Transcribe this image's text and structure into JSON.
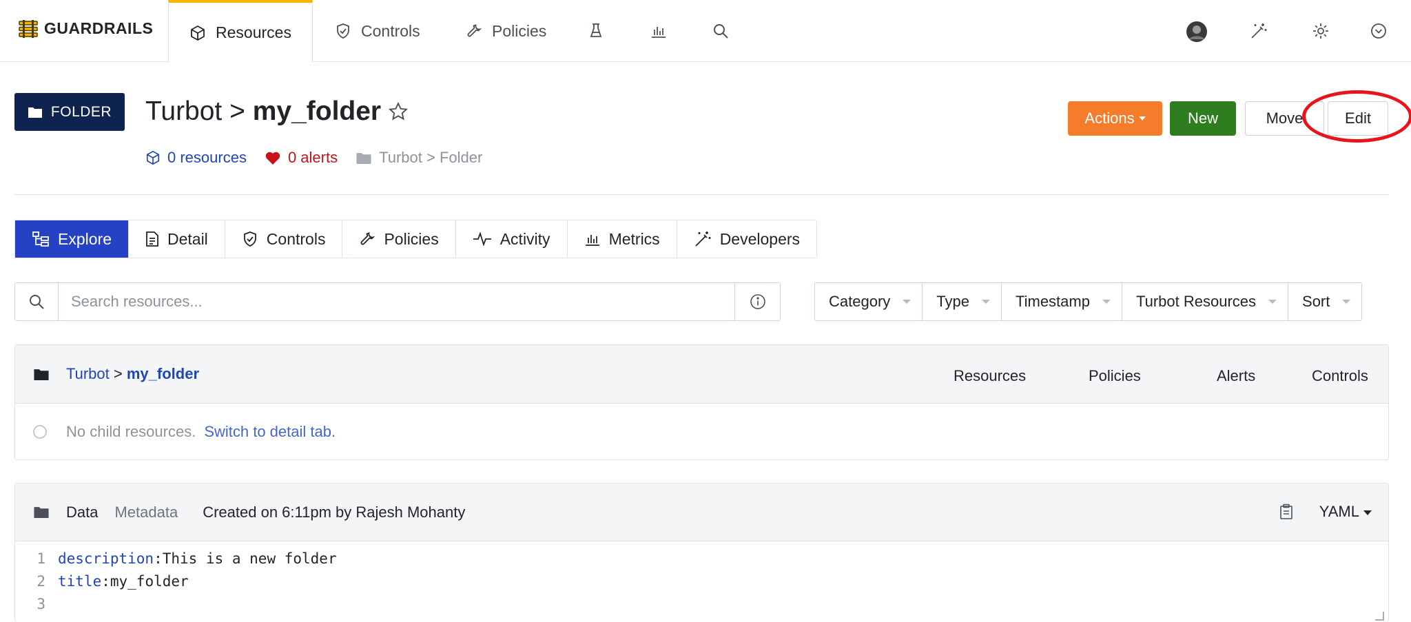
{
  "brand": {
    "name": "GUARDRAILS"
  },
  "nav": {
    "tabs": [
      {
        "label": "Resources",
        "icon": "cube-icon",
        "active": true
      },
      {
        "label": "Controls",
        "icon": "shield-check-icon"
      },
      {
        "label": "Policies",
        "icon": "wrench-icon"
      }
    ],
    "icon_tabs": [
      "flask-icon",
      "bar-chart-icon",
      "search-icon"
    ],
    "right_icons": [
      "user-avatar",
      "magic-wand-icon",
      "gear-icon",
      "chevron-circle-icon"
    ]
  },
  "header": {
    "type_badge": "FOLDER",
    "title_prefix": "Turbot > ",
    "title_name": "my_folder",
    "resources_link": "0 resources",
    "alerts_link": "0 alerts",
    "type_path": "Turbot > Folder",
    "buttons": {
      "actions": "Actions",
      "new": "New",
      "move": "Move",
      "edit": "Edit"
    }
  },
  "subtabs": [
    {
      "label": "Explore",
      "icon": "hierarchy-icon",
      "active": true
    },
    {
      "label": "Detail",
      "icon": "document-icon"
    },
    {
      "label": "Controls",
      "icon": "shield-check-icon"
    },
    {
      "label": "Policies",
      "icon": "wrench-icon"
    },
    {
      "label": "Activity",
      "icon": "pulse-icon"
    },
    {
      "label": "Metrics",
      "icon": "bar-chart-icon"
    },
    {
      "label": "Developers",
      "icon": "magic-wand-icon"
    }
  ],
  "search": {
    "placeholder": "Search resources..."
  },
  "filters": [
    "Category",
    "Type",
    "Timestamp",
    "Turbot Resources",
    "Sort"
  ],
  "explore": {
    "crumb_parent": "Turbot",
    "crumb_sep": " > ",
    "crumb_current": "my_folder",
    "columns": [
      "Resources",
      "Policies",
      "Alerts",
      "Controls"
    ],
    "empty_text": "No child resources.",
    "empty_link": "Switch to detail tab."
  },
  "data_panel": {
    "tab_data": "Data",
    "tab_metadata": "Metadata",
    "created": "Created on 6:11pm by Rajesh Mohanty",
    "format": "YAML",
    "lines": [
      {
        "num": "1",
        "key": "description",
        "value": "This is a new folder"
      },
      {
        "num": "2",
        "key": "title",
        "value": "my_folder"
      },
      {
        "num": "3",
        "key": "",
        "value": ""
      }
    ]
  },
  "colors": {
    "brand_navy": "#0f2350",
    "accent_blue": "#2442c3",
    "actions_orange": "#f57c2a",
    "new_green": "#2e7d1f",
    "alert_red": "#c81219",
    "active_tab_bar": "#f7b500",
    "annotation_red": "#e8141a"
  }
}
